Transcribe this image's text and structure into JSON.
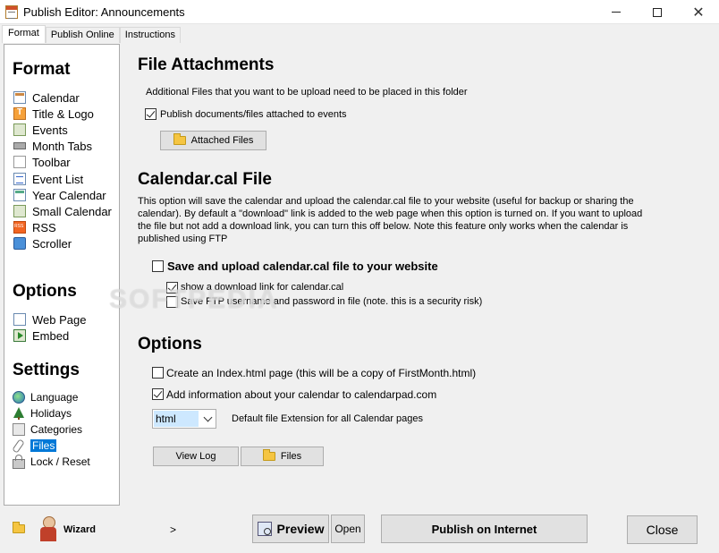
{
  "window": {
    "title": "Publish Editor: Announcements"
  },
  "tabs": [
    {
      "label": "Format",
      "active": true
    },
    {
      "label": "Publish Online",
      "active": false
    },
    {
      "label": "Instructions",
      "active": false
    }
  ],
  "sidebar": {
    "format_heading": "Format",
    "format_items": [
      {
        "label": "Calendar",
        "icon": "calendar-icon"
      },
      {
        "label": "Title & Logo",
        "icon": "title-logo-icon"
      },
      {
        "label": "Events",
        "icon": "events-icon"
      },
      {
        "label": "Month Tabs",
        "icon": "month-tabs-icon"
      },
      {
        "label": "Toolbar",
        "icon": "toolbar-icon"
      },
      {
        "label": "Event List",
        "icon": "event-list-icon"
      },
      {
        "label": "Year Calendar",
        "icon": "year-calendar-icon"
      },
      {
        "label": "Small Calendar",
        "icon": "small-calendar-icon"
      },
      {
        "label": "RSS",
        "icon": "rss-icon"
      },
      {
        "label": "Scroller",
        "icon": "scroller-icon"
      }
    ],
    "options_heading": "Options",
    "options_items": [
      {
        "label": "Web Page",
        "icon": "web-page-icon"
      },
      {
        "label": "Embed",
        "icon": "embed-icon"
      }
    ],
    "settings_heading": "Settings",
    "settings_items": [
      {
        "label": "Language",
        "icon": "globe-icon"
      },
      {
        "label": "Holidays",
        "icon": "tree-icon"
      },
      {
        "label": "Categories",
        "icon": "categories-icon"
      },
      {
        "label": "Files",
        "icon": "paperclip-icon",
        "selected": true
      },
      {
        "label": "Lock / Reset",
        "icon": "lock-icon"
      }
    ]
  },
  "file_attachments": {
    "heading": "File Attachments",
    "description": "Additional Files that you want to be upload need to be placed in this folder",
    "publish_checkbox_label": "Publish documents/files attached to events",
    "publish_checked": true,
    "attached_files_button": "Attached Files"
  },
  "calendar_cal": {
    "heading": "Calendar.cal File",
    "paragraph": "This option will save the calendar and upload the calendar.cal file to your website (useful for backup or sharing the calendar). By default a \"download\" link is added to the web page when this option is turned on.  If you want to upload the file but not add a download link, you can turn this off below. Note this feature only works when the calendar is published using FTP",
    "save_upload_label": "Save and upload calendar.cal file to your website",
    "save_upload_checked": false,
    "download_link_label": "show a download link for calendar.cal",
    "download_link_checked": true,
    "save_ftp_label": "Save FTP username  and password in file (note. this is a security risk)",
    "save_ftp_checked": false
  },
  "options": {
    "heading": "Options",
    "create_index_label": "Create an Index.html page  (this will be a copy of FirstMonth.html)",
    "create_index_checked": false,
    "add_info_label": "Add information about your calendar to calendarpad.com",
    "add_info_checked": true,
    "extension_value": "html",
    "extension_caption": "Default file Extension for all Calendar pages",
    "view_log_button": "View Log",
    "files_button": "Files"
  },
  "watermark": "SOFTPEDIA",
  "bottom_bar": {
    "wizard_label": "Wizard",
    "wizard_arrow": ">",
    "preview_button": "Preview",
    "open_button": "Open",
    "publish_button": "Publish on Internet",
    "close_button": "Close"
  }
}
